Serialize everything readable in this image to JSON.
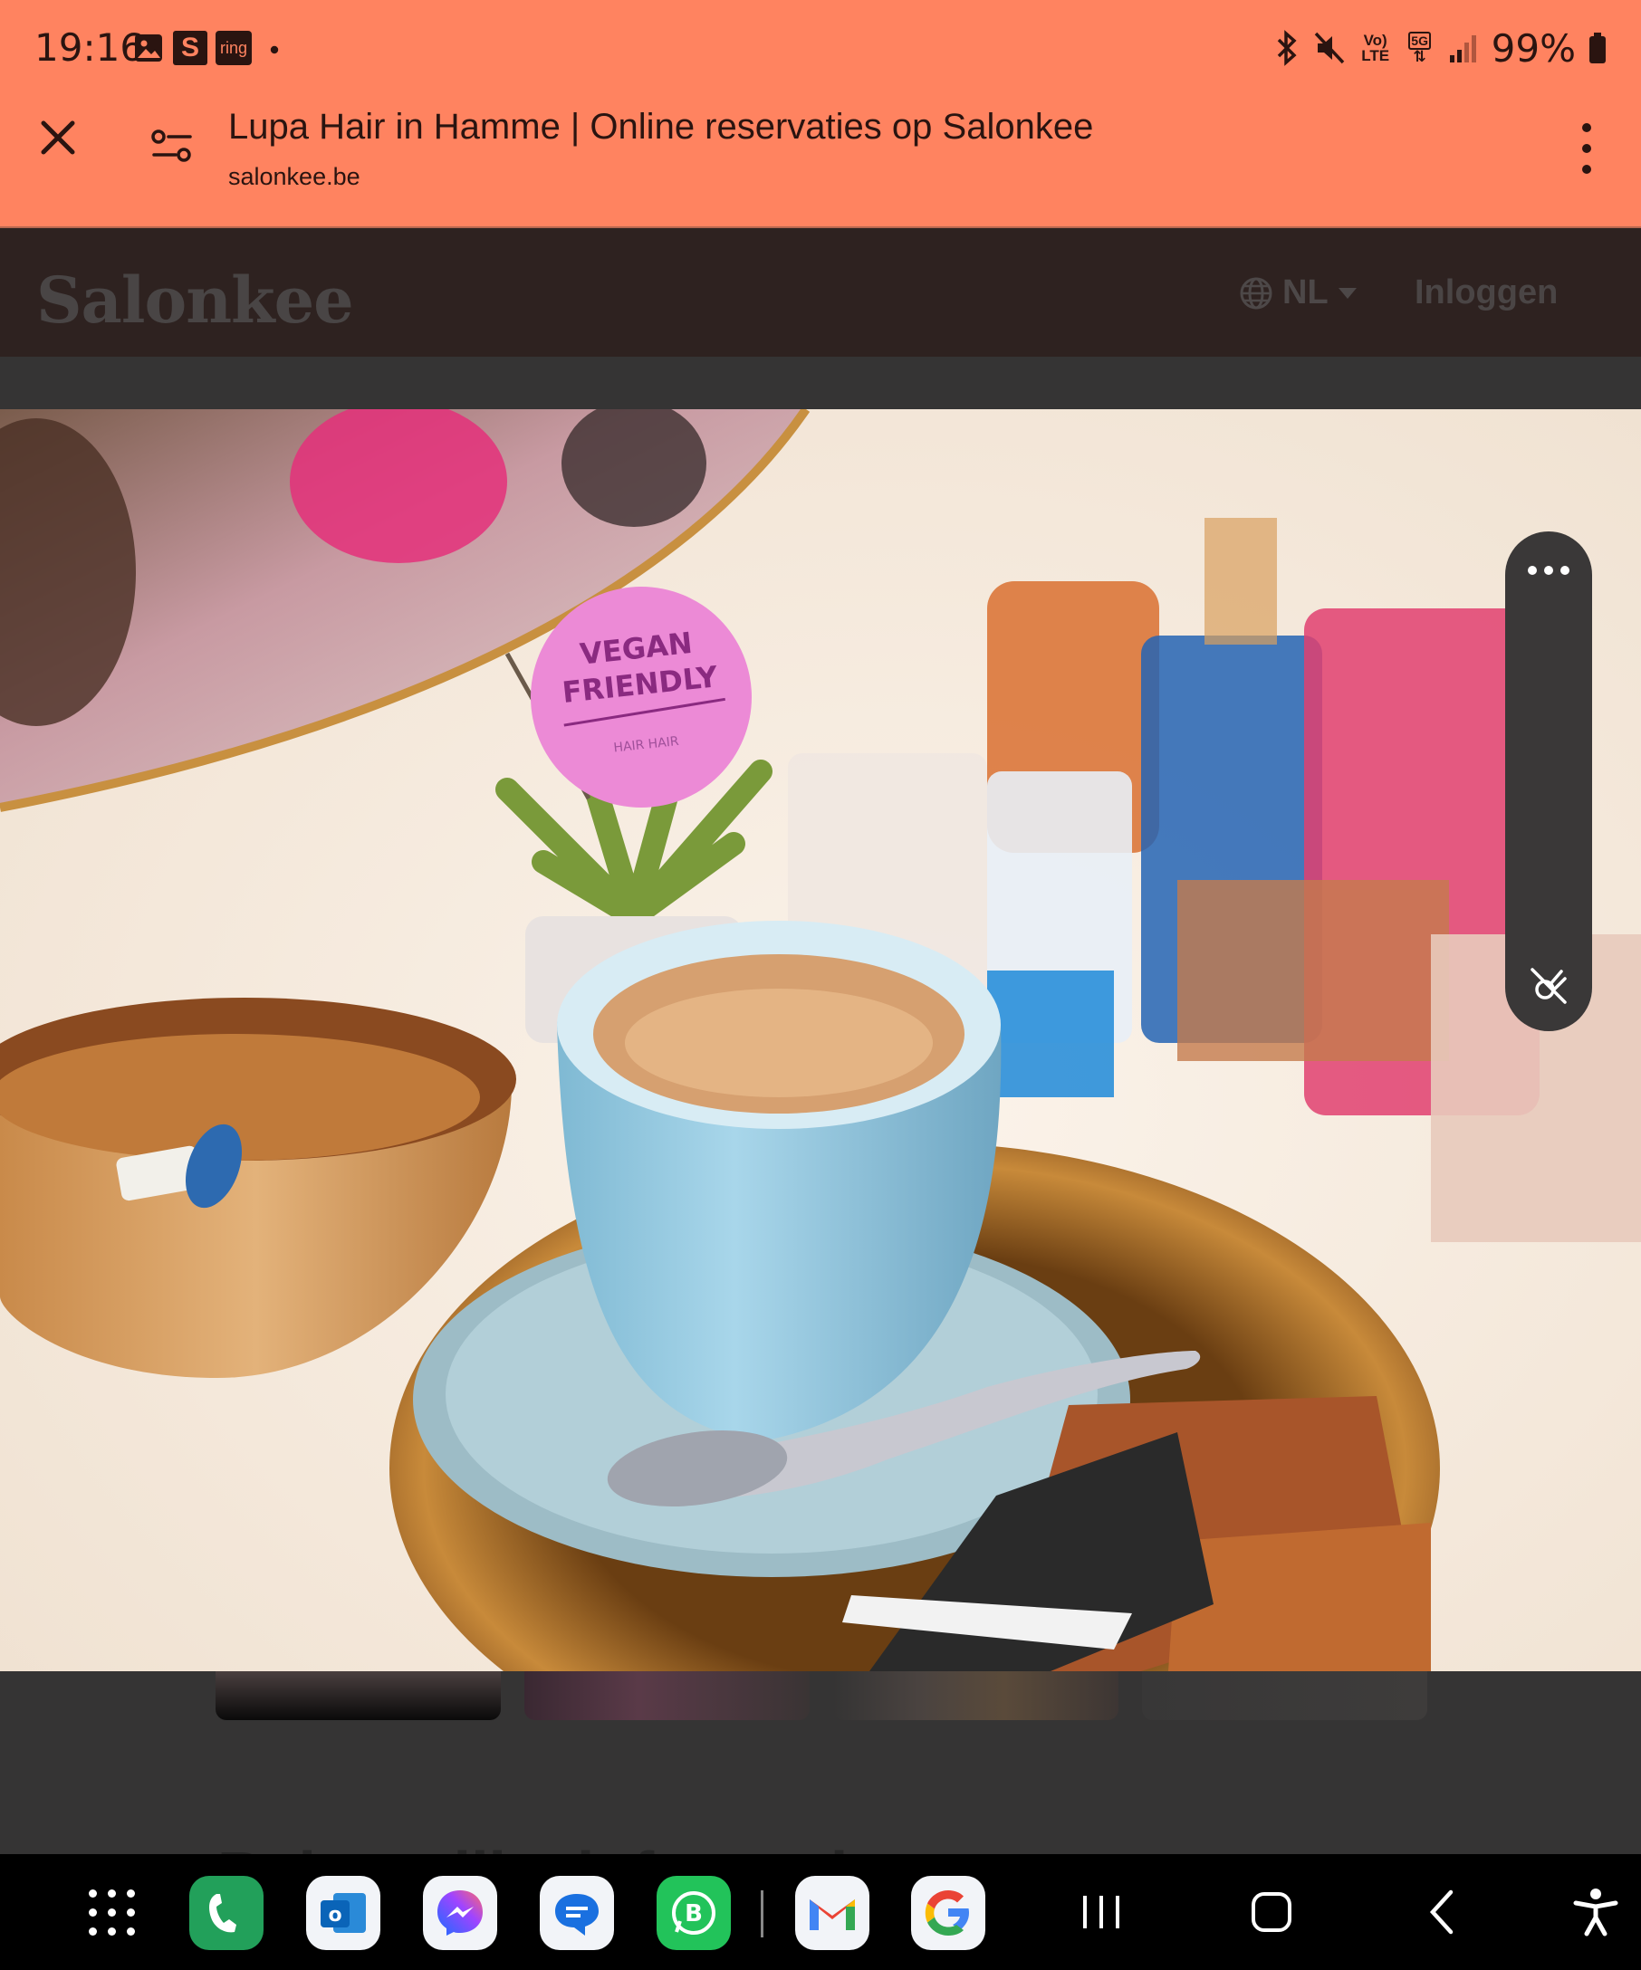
{
  "status_bar": {
    "time": "19:16",
    "s_badge": "S",
    "ring_badge": "ring",
    "network_volte": "Vo)\nLTE",
    "network_5g": "5G",
    "battery": "99%"
  },
  "browser": {
    "title": "Lupa Hair in Hamme | Online reservaties op Salonkee",
    "url": "salonkee.be",
    "colors": {
      "toolbar": "#ff8360",
      "text": "#2a1410"
    }
  },
  "site": {
    "logo": "Salonkee",
    "language": "NL",
    "login": "Inloggen",
    "section_heading_peek": "Belangrijke informatie"
  },
  "photo": {
    "sticker_line1": "VEGAN",
    "sticker_line2": "FRIENDLY",
    "sticker_line3": "HAIR HAIR"
  },
  "taskbar": {
    "apps": [
      "app-grid-icon",
      "phone-icon",
      "outlook-icon",
      "messenger-icon",
      "messages-icon",
      "whatsapp-business-icon",
      "gmail-icon",
      "google-icon"
    ],
    "whatsapp_letter": "B",
    "outlook_letter": "o"
  }
}
